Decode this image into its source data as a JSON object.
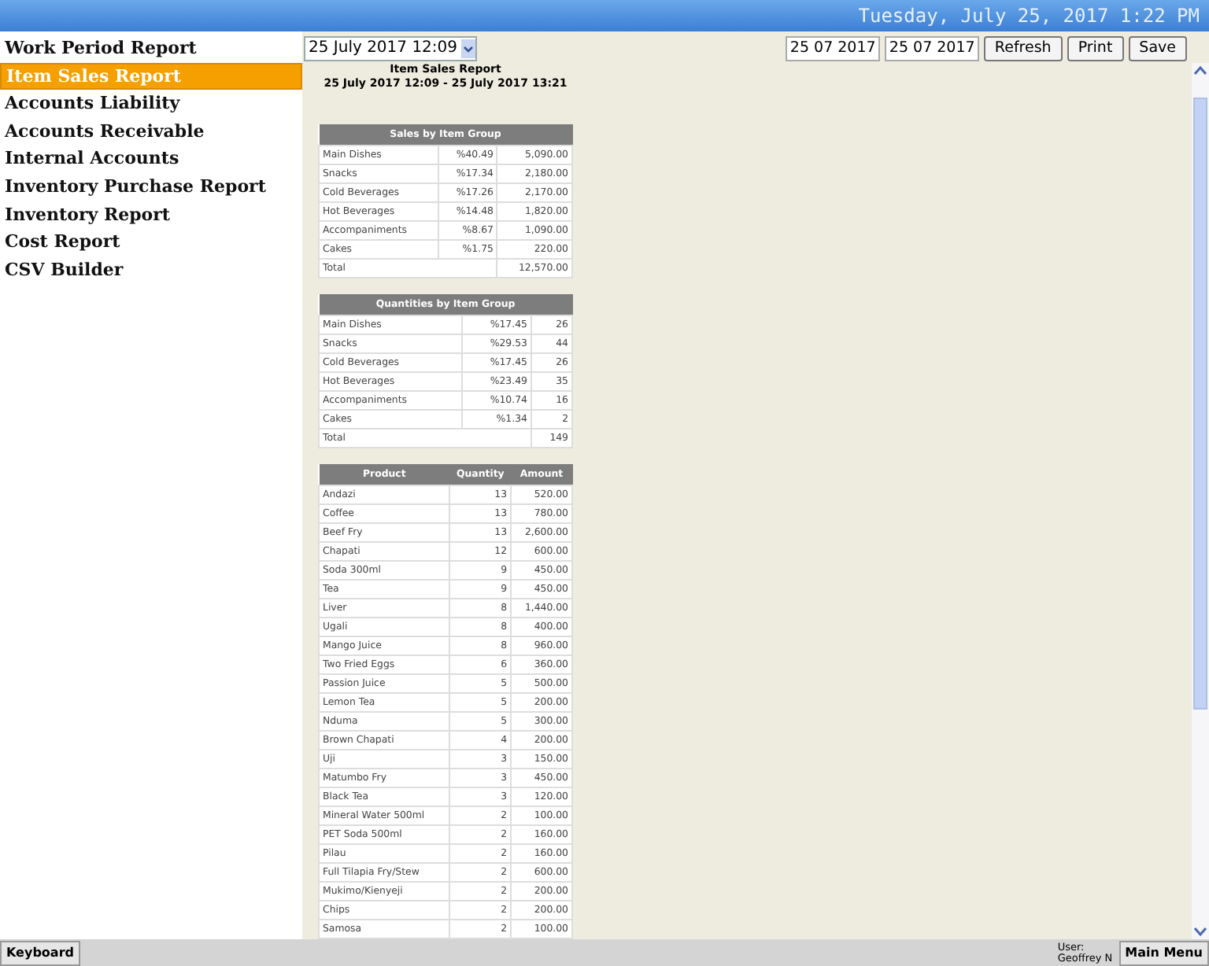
{
  "header": {
    "clock": "Tuesday, July 25, 2017 1:22 PM"
  },
  "sidebar": {
    "items": [
      {
        "label": "Work Period Report",
        "selected": false
      },
      {
        "label": "Item Sales Report",
        "selected": true
      },
      {
        "label": "Accounts Liability",
        "selected": false
      },
      {
        "label": "Accounts Receivable",
        "selected": false
      },
      {
        "label": "Internal Accounts",
        "selected": false
      },
      {
        "label": "Inventory Purchase Report",
        "selected": false
      },
      {
        "label": "Inventory Report",
        "selected": false
      },
      {
        "label": "Cost Report",
        "selected": false
      },
      {
        "label": "CSV Builder",
        "selected": false
      }
    ]
  },
  "toolbar": {
    "period": "25 July 2017 12:09",
    "start_date": "25 07 2017",
    "end_date": "25 07 2017",
    "buttons": [
      "Refresh",
      "Print",
      "Save"
    ]
  },
  "report": {
    "title": "Item Sales Report",
    "range": "25 July 2017 12:09 - 25 July 2017 13:21",
    "sales_by_group": {
      "title": "Sales by Item Group",
      "rows": [
        [
          "Main Dishes",
          "%40.49",
          "5,090.00"
        ],
        [
          "Snacks",
          "%17.34",
          "2,180.00"
        ],
        [
          "Cold Beverages",
          "%17.26",
          "2,170.00"
        ],
        [
          "Hot Beverages",
          "%14.48",
          "1,820.00"
        ],
        [
          "Accompaniments",
          "%8.67",
          "1,090.00"
        ],
        [
          "Cakes",
          "%1.75",
          "220.00"
        ]
      ],
      "total": [
        "Total",
        "12,570.00"
      ]
    },
    "quantities_by_group": {
      "title": "Quantities by Item Group",
      "rows": [
        [
          "Main Dishes",
          "%17.45",
          "26"
        ],
        [
          "Snacks",
          "%29.53",
          "44"
        ],
        [
          "Cold Beverages",
          "%17.45",
          "26"
        ],
        [
          "Hot Beverages",
          "%23.49",
          "35"
        ],
        [
          "Accompaniments",
          "%10.74",
          "16"
        ],
        [
          "Cakes",
          "%1.34",
          "2"
        ]
      ],
      "total": [
        "Total",
        "149"
      ]
    },
    "products": {
      "columns": [
        "Product",
        "Quantity",
        "Amount"
      ],
      "rows": [
        [
          "Andazi",
          "13",
          "520.00"
        ],
        [
          "Coffee",
          "13",
          "780.00"
        ],
        [
          "Beef Fry",
          "13",
          "2,600.00"
        ],
        [
          "Chapati",
          "12",
          "600.00"
        ],
        [
          "Soda 300ml",
          "9",
          "450.00"
        ],
        [
          "Tea",
          "9",
          "450.00"
        ],
        [
          "Liver",
          "8",
          "1,440.00"
        ],
        [
          "Ugali",
          "8",
          "400.00"
        ],
        [
          "Mango Juice",
          "8",
          "960.00"
        ],
        [
          "Two Fried Eggs",
          "6",
          "360.00"
        ],
        [
          "Passion Juice",
          "5",
          "500.00"
        ],
        [
          "Lemon Tea",
          "5",
          "200.00"
        ],
        [
          "Nduma",
          "5",
          "300.00"
        ],
        [
          "Brown Chapati",
          "4",
          "200.00"
        ],
        [
          "Uji",
          "3",
          "150.00"
        ],
        [
          "Matumbo Fry",
          "3",
          "450.00"
        ],
        [
          "Black Tea",
          "3",
          "120.00"
        ],
        [
          "Mineral Water 500ml",
          "2",
          "100.00"
        ],
        [
          "PET Soda 500ml",
          "2",
          "160.00"
        ],
        [
          "Pilau",
          "2",
          "160.00"
        ],
        [
          "Full Tilapia Fry/Stew",
          "2",
          "600.00"
        ],
        [
          "Mukimo/Kienyeji",
          "2",
          "200.00"
        ],
        [
          "Chips",
          "2",
          "200.00"
        ],
        [
          "Samosa",
          "2",
          "100.00"
        ]
      ]
    }
  },
  "footer": {
    "keyboard": "Keyboard",
    "user_label": "User:",
    "user_name": "Geoffrey N",
    "main_menu": "Main Menu"
  }
}
